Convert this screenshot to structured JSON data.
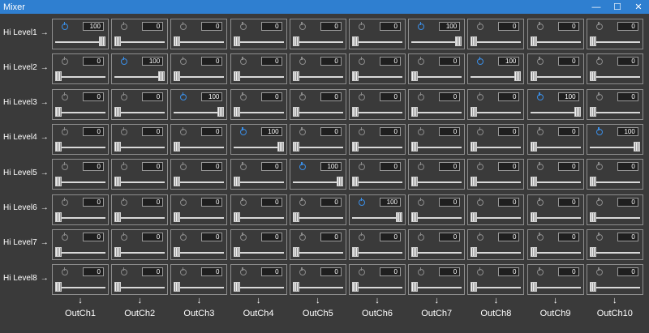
{
  "window": {
    "title": "Mixer",
    "minimize_label": "—",
    "maximize_label": "☐",
    "close_label": "✕"
  },
  "rows": [
    {
      "label": "Hi Level1",
      "arrow": "→"
    },
    {
      "label": "Hi Level2",
      "arrow": "→"
    },
    {
      "label": "Hi Level3",
      "arrow": "→"
    },
    {
      "label": "Hi Level4",
      "arrow": "→"
    },
    {
      "label": "Hi Level5",
      "arrow": "→"
    },
    {
      "label": "Hi Level6",
      "arrow": "→"
    },
    {
      "label": "Hi Level7",
      "arrow": "→"
    },
    {
      "label": "Hi Level8",
      "arrow": "→"
    }
  ],
  "columns": [
    {
      "label": "OutCh1",
      "arrow": "↓"
    },
    {
      "label": "OutCh2",
      "arrow": "↓"
    },
    {
      "label": "OutCh3",
      "arrow": "↓"
    },
    {
      "label": "OutCh4",
      "arrow": "↓"
    },
    {
      "label": "OutCh5",
      "arrow": "↓"
    },
    {
      "label": "OutCh6",
      "arrow": "↓"
    },
    {
      "label": "OutCh7",
      "arrow": "↓"
    },
    {
      "label": "OutCh8",
      "arrow": "↓"
    },
    {
      "label": "OutCh9",
      "arrow": "↓"
    },
    {
      "label": "OutCh10",
      "arrow": "↓"
    }
  ],
  "matrix": [
    [
      100,
      0,
      0,
      0,
      0,
      0,
      100,
      0,
      0,
      0
    ],
    [
      0,
      100,
      0,
      0,
      0,
      0,
      0,
      100,
      0,
      0
    ],
    [
      0,
      0,
      100,
      0,
      0,
      0,
      0,
      0,
      100,
      0
    ],
    [
      0,
      0,
      0,
      100,
      0,
      0,
      0,
      0,
      0,
      100
    ],
    [
      0,
      0,
      0,
      0,
      100,
      0,
      0,
      0,
      0,
      0
    ],
    [
      0,
      0,
      0,
      0,
      0,
      100,
      0,
      0,
      0,
      0
    ],
    [
      0,
      0,
      0,
      0,
      0,
      0,
      0,
      0,
      0,
      0
    ],
    [
      0,
      0,
      0,
      0,
      0,
      0,
      0,
      0,
      0,
      0
    ]
  ],
  "slider_max": 100,
  "colors": {
    "titlebar": "#2f7fd0",
    "background": "#3a3a3a",
    "power_on": "#3a8ee6",
    "power_off": "#8a8a8a"
  }
}
